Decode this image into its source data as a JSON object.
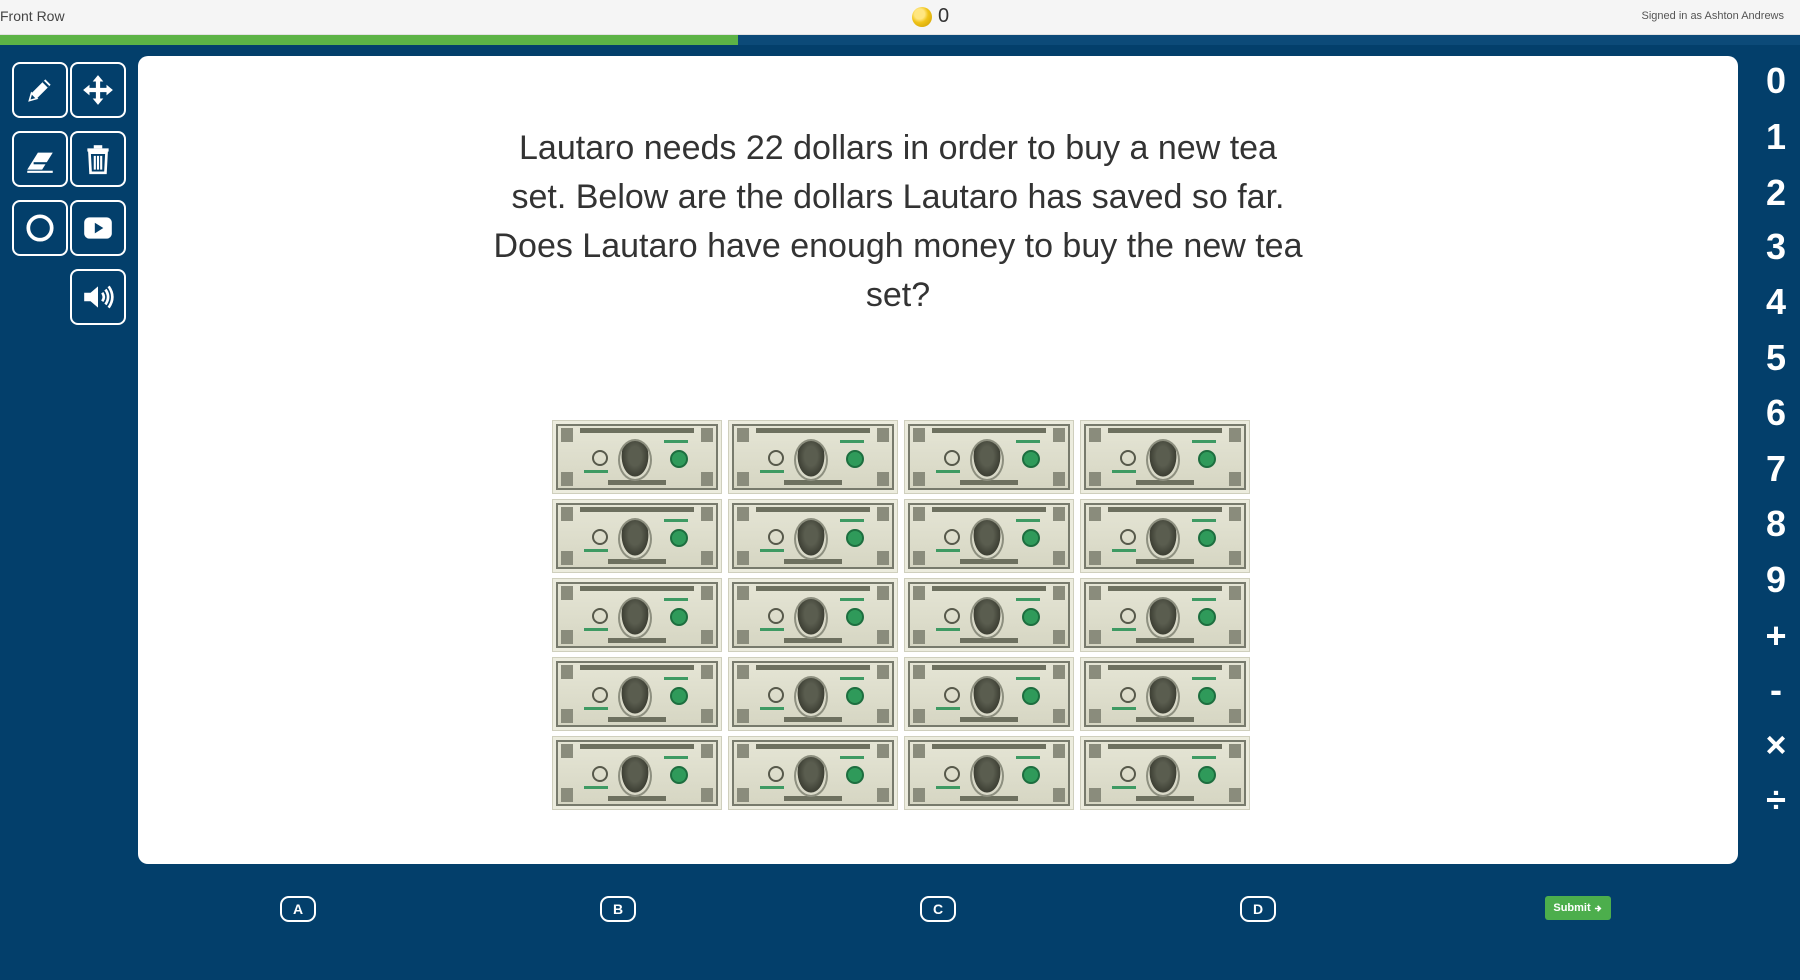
{
  "topbar": {
    "brand": "Front Row",
    "coin_count": "0",
    "signed_in": "Signed in as Ashton Andrews"
  },
  "progress": {
    "fraction": 0.41,
    "fill_color": "#5cb346"
  },
  "tools": [
    {
      "name": "pencil-icon"
    },
    {
      "name": "move-icon"
    },
    {
      "name": "eraser-icon"
    },
    {
      "name": "trash-icon"
    },
    {
      "name": "circle-icon"
    },
    {
      "name": "video-icon"
    },
    {
      "name": "speaker-icon"
    }
  ],
  "question": {
    "text": "Lautaro needs 22 dollars in order to buy a new tea set. Below are the dollars Lautaro has saved so far. Does Lautaro have enough money to buy the new tea set?",
    "bill_count": 20,
    "bill_denomination": "one dollar"
  },
  "number_pad": [
    "0",
    "1",
    "2",
    "3",
    "4",
    "5",
    "6",
    "7",
    "8",
    "9",
    "+",
    "-",
    "×",
    "÷"
  ],
  "answers": [
    {
      "label": "A"
    },
    {
      "label": "B"
    },
    {
      "label": "C"
    },
    {
      "label": "D"
    }
  ],
  "submit": {
    "label": "Submit",
    "icon": "arrow-right-icon"
  },
  "colors": {
    "background": "#033f6b",
    "card": "#ffffff",
    "progress": "#5cb346",
    "submit": "#4cae4c"
  }
}
